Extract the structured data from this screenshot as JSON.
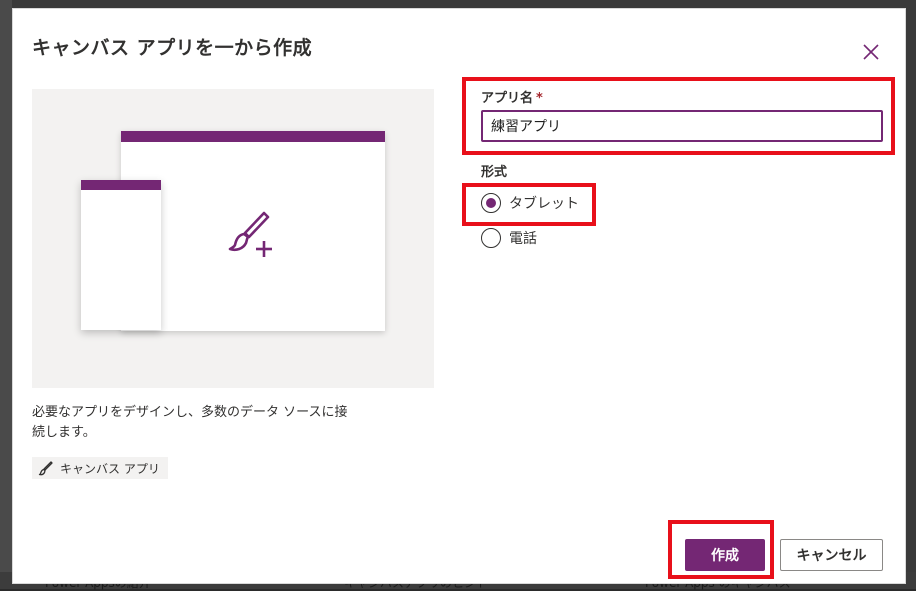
{
  "dialog": {
    "title": "キャンバス アプリを一から作成",
    "close_icon": "close-icon"
  },
  "illustration": {
    "icon": "paintbrush-plus-icon",
    "accent": "#742774"
  },
  "description": {
    "line1": "必要なアプリをデザインし、多数のデータ ソースに接",
    "line2": "続します。"
  },
  "tag": {
    "icon": "paintbrush-icon",
    "label": "キャンバス アプリ"
  },
  "form": {
    "app_name_label": "アプリ名",
    "required_mark": "*",
    "app_name_value": "練習アプリ",
    "format_label": "形式",
    "options": [
      {
        "label": "タブレット",
        "selected": true
      },
      {
        "label": "電話",
        "selected": false
      }
    ]
  },
  "buttons": {
    "create": "作成",
    "cancel": "キャンセル"
  },
  "background": {
    "texts": [
      "Power Appsの紹介",
      "キャンバスアプリのヒント",
      "Power Apps のキャンバス"
    ]
  },
  "colors": {
    "brand": "#742774",
    "highlight": "#e8101a"
  }
}
